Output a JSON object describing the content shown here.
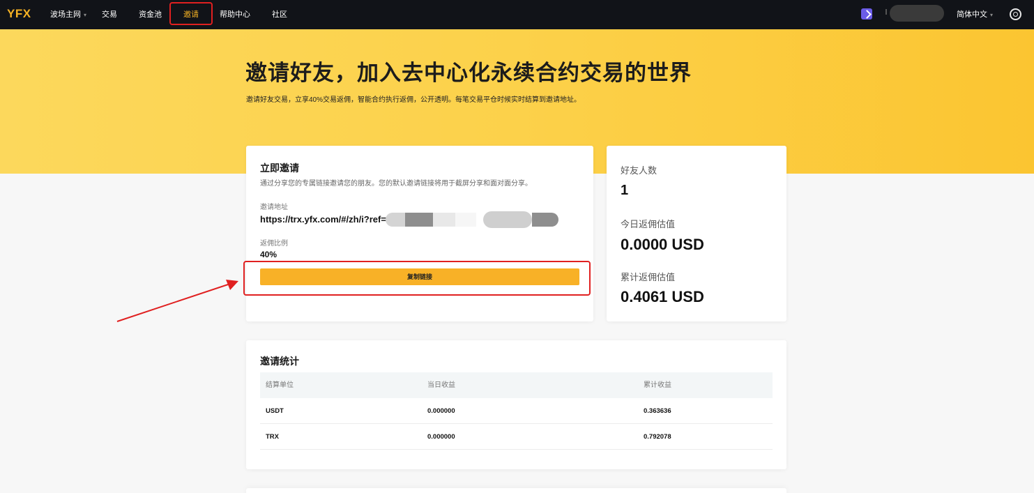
{
  "nav": {
    "logo": "YFX",
    "items": [
      {
        "label": "波场主网",
        "dropdown": true
      },
      {
        "label": "交易"
      },
      {
        "label": "资金池"
      },
      {
        "label": "邀请",
        "active": true
      },
      {
        "label": "帮助中心"
      },
      {
        "label": "社区"
      }
    ],
    "caret": "▾",
    "language": "简体中文",
    "accent_color": "#f5b224"
  },
  "hero": {
    "title": "邀请好友，加入去中心化永续合约交易的世界",
    "subtitle": "邀请好友交易，立享40%交易返佣，智能合约执行返佣，公开透明。每笔交易平仓时候实时结算到邀请地址。"
  },
  "invite": {
    "title": "立即邀请",
    "description": "通过分享您的专属链接邀请您的朋友。您的默认邀请链接将用于截屏分享和面对面分享。",
    "address_label": "邀请地址",
    "address_value": "https://trx.yfx.com/#/zh/i?ref=",
    "rate_label": "返佣比例",
    "rate_value": "40%",
    "copy_button": "复制链接"
  },
  "stats": {
    "friends_label": "好友人数",
    "friends_value": "1",
    "today_label": "今日返佣估值",
    "today_value": "0.0000 USD",
    "total_label": "累计返佣估值",
    "total_value": "0.4061 USD"
  },
  "table": {
    "title": "邀请统计",
    "columns": [
      "结算单位",
      "当日收益",
      "累计收益"
    ],
    "rows": [
      [
        "USDT",
        "0.000000",
        "0.363636"
      ],
      [
        "TRX",
        "0.000000",
        "0.792078"
      ]
    ]
  }
}
